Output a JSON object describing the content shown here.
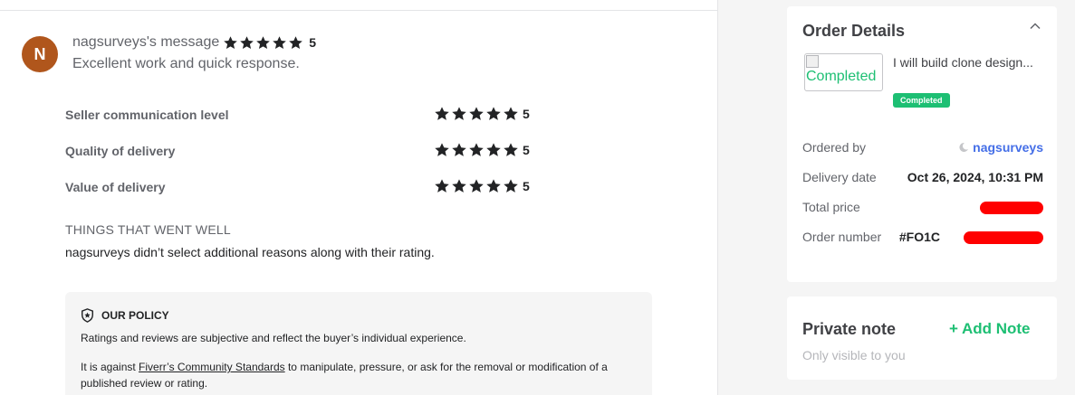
{
  "review": {
    "avatar_initial": "N",
    "author_message": "nagsurveys's message",
    "overall_rating": "5",
    "text": "Excellent work and quick response."
  },
  "criteria": [
    {
      "label": "Seller communication level",
      "rating": "5"
    },
    {
      "label": "Quality of delivery",
      "rating": "5"
    },
    {
      "label": "Value of delivery",
      "rating": "5"
    }
  ],
  "things_went_well": {
    "title": "THINGS THAT WENT WELL",
    "text": "nagsurveys didn’t select additional reasons along with their rating."
  },
  "policy": {
    "title": "OUR POLICY",
    "p1": "Ratings and reviews are subjective and reflect the buyer’s individual experience.",
    "p2_before": "It is against ",
    "p2_link": "Fiverr’s Community Standards",
    "p2_after": " to manipulate, pressure, or ask for the removal or modification of a published review or rating."
  },
  "order": {
    "title": "Order Details",
    "thumb_alt": "Completed",
    "gig_title": "I will build clone design...",
    "status": "Completed",
    "rows": {
      "ordered_by_label": "Ordered by",
      "ordered_by_value": "nagsurveys",
      "delivery_label": "Delivery date",
      "delivery_value": "Oct 26, 2024, 10:31 PM",
      "price_label": "Total price",
      "order_number_label": "Order number",
      "order_number_value": "#FO1C"
    }
  },
  "note": {
    "title": "Private note",
    "subtitle": "Only visible to you",
    "add_label": "Add Note"
  },
  "colors": {
    "brand_green": "#1dbf73",
    "avatar_bg": "#b0561c",
    "link_blue": "#446ee7",
    "redaction": "#ff0000"
  },
  "icons": {
    "star": "star-icon",
    "shield": "shield-icon",
    "chevron": "chevron-up-icon",
    "plus": "plus-icon"
  }
}
